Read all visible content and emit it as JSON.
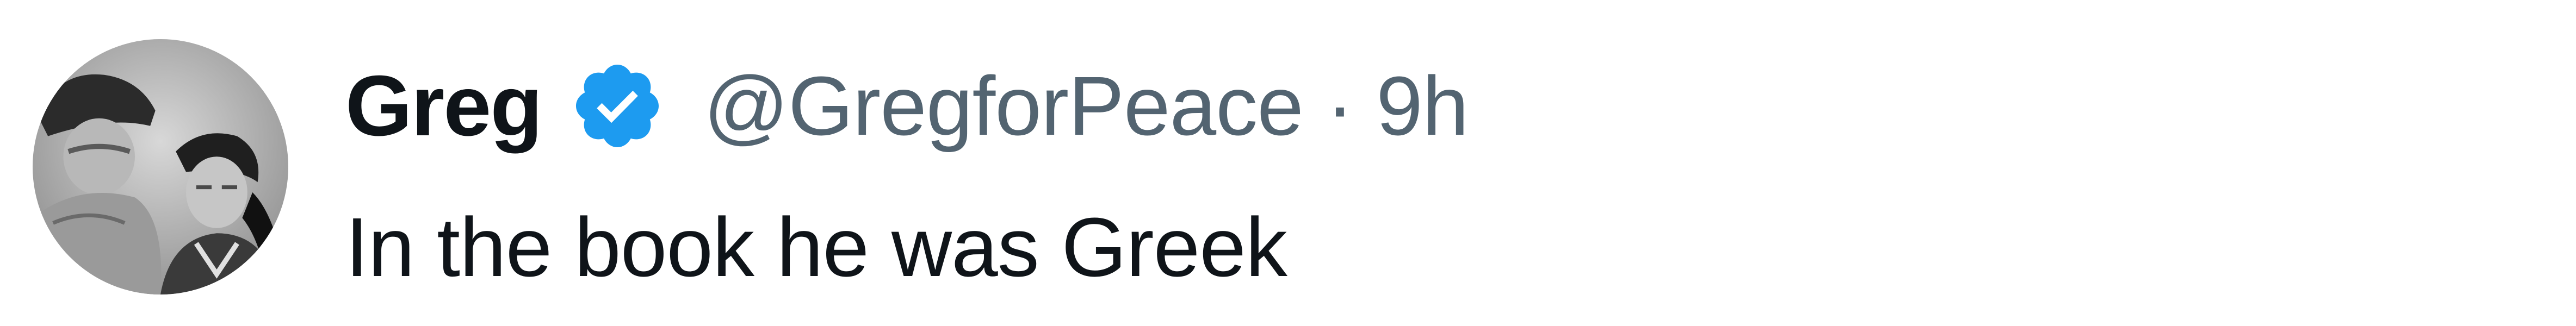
{
  "tweet": {
    "author": {
      "display_name": "Greg",
      "handle": "@GregforPeace",
      "verified": true,
      "verified_icon": "verified-badge-icon",
      "avatar": "profile-photo-avatar"
    },
    "separator": "·",
    "timestamp": "9h",
    "text": "In the book he was Greek"
  },
  "colors": {
    "primary_text": "#0f1419",
    "secondary_text": "#536471",
    "verified_blue": "#1d9bf0",
    "background": "#ffffff"
  }
}
